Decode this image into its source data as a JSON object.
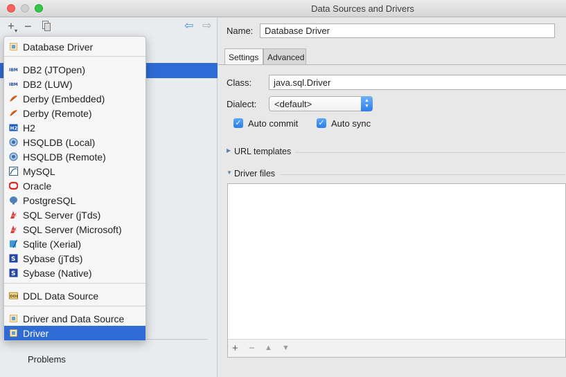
{
  "window": {
    "title": "Data Sources and Drivers"
  },
  "left_toolbar": {
    "add": "+",
    "add_arrow": "▾",
    "remove": "−",
    "back": "⇦",
    "forward": "⇨"
  },
  "left_pane": {
    "problems": "Problems"
  },
  "popup_menu": {
    "items": [
      {
        "label": "Database Driver",
        "icon": "driver-icon"
      },
      {
        "label": "DB2 (JTOpen)",
        "icon": "ibm-icon"
      },
      {
        "label": "DB2 (LUW)",
        "icon": "ibm-icon"
      },
      {
        "label": "Derby (Embedded)",
        "icon": "derby-icon"
      },
      {
        "label": "Derby (Remote)",
        "icon": "derby-icon"
      },
      {
        "label": "H2",
        "icon": "h2-icon"
      },
      {
        "label": "HSQLDB (Local)",
        "icon": "hsqldb-icon"
      },
      {
        "label": "HSQLDB (Remote)",
        "icon": "hsqldb-icon"
      },
      {
        "label": "MySQL",
        "icon": "mysql-icon"
      },
      {
        "label": "Oracle",
        "icon": "oracle-icon"
      },
      {
        "label": "PostgreSQL",
        "icon": "postgresql-icon"
      },
      {
        "label": "SQL Server (jTds)",
        "icon": "sqlserver-icon"
      },
      {
        "label": "SQL Server (Microsoft)",
        "icon": "sqlserver-icon"
      },
      {
        "label": "Sqlite (Xerial)",
        "icon": "sqlite-icon"
      },
      {
        "label": "Sybase (jTds)",
        "icon": "sybase-icon"
      },
      {
        "label": "Sybase (Native)",
        "icon": "sybase-icon"
      },
      {
        "label": "DDL Data Source",
        "icon": "ddl-icon"
      },
      {
        "label": "Driver and Data Source",
        "icon": "driver-icon"
      },
      {
        "label": "Driver",
        "icon": "driver-icon",
        "selected": true
      }
    ]
  },
  "form": {
    "name_label": "Name:",
    "name_value": "Database Driver",
    "tabs": [
      "Settings",
      "Advanced"
    ],
    "active_tab": "Settings",
    "class_label": "Class:",
    "class_value": "java.sql.Driver",
    "dialect_label": "Dialect:",
    "dialect_value": "<default>",
    "auto_commit": {
      "label": "Auto commit",
      "checked": true
    },
    "auto_sync": {
      "label": "Auto sync",
      "checked": true
    },
    "url_templates": "URL templates",
    "driver_files": "Driver files"
  },
  "files_toolbar": {
    "add": "+",
    "remove": "−",
    "up": "▲",
    "down": "▼"
  },
  "colors": {
    "selection": "#2f6bd4",
    "accent": "#3d8fd8"
  }
}
